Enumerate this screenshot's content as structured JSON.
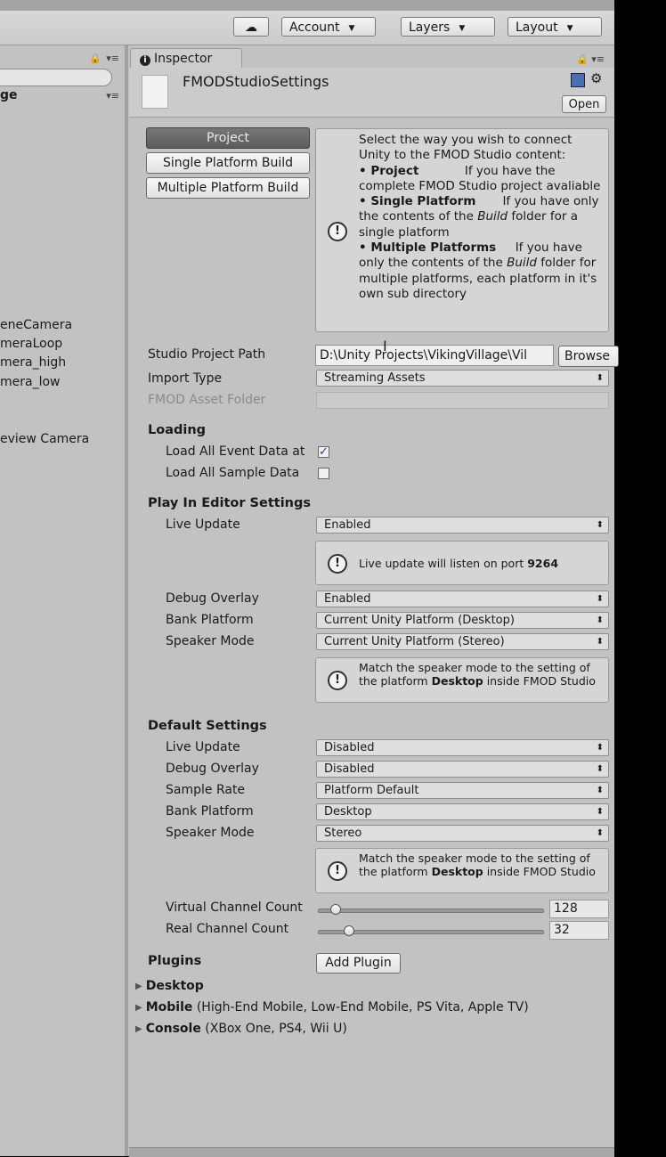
{
  "toolbar": {
    "account_label": "Account",
    "layers_label": "Layers",
    "layout_label": "Layout",
    "cloud_icon": "cloud-icon"
  },
  "hierarchy": {
    "title": "ge",
    "items": [
      "eneCamera",
      "meraLoop",
      "mera_high",
      "mera_low",
      "eview Camera"
    ]
  },
  "inspector": {
    "tab_label": "Inspector",
    "asset_name": "FMODStudioSettings",
    "open_label": "Open",
    "mode_buttons": [
      "Project",
      "Single Platform Build",
      "Multiple Platform Build"
    ],
    "active_mode": "Project",
    "help": {
      "intro": "Select the way you wish to connect Unity to the FMOD Studio content:",
      "project_title": "• Project",
      "project_text": "If you have the complete FMOD Studio project avaliable",
      "single_title": "• Single Platform",
      "single_text_a": "If you have only the contents of the",
      "single_build": "Build",
      "single_text_b": "folder for a single platform",
      "multi_title": "• Multiple Platforms",
      "multi_text_a": "If you have only the contents of the",
      "multi_build": "Build",
      "multi_text_b": "folder for multiple platforms, each platform in it's own sub directory"
    },
    "studio_project_path_label": "Studio Project Path",
    "studio_project_path_value": "D:\\Unity Projects\\VikingVillage\\Vil",
    "browse_label": "Browse",
    "import_type_label": "Import Type",
    "import_type_value": "Streaming Assets",
    "asset_folder_label": "FMOD Asset Folder",
    "loading": {
      "title": "Loading",
      "load_events_label": "Load All Event Data at",
      "load_events_checked": true,
      "load_samples_label": "Load All Sample Data",
      "load_samples_checked": false
    },
    "play_in_editor": {
      "title": "Play In Editor Settings",
      "live_update_label": "Live Update",
      "live_update_value": "Enabled",
      "live_info_text": "Live update will listen on port",
      "live_info_port": "9264",
      "debug_overlay_label": "Debug Overlay",
      "debug_overlay_value": "Enabled",
      "bank_platform_label": "Bank Platform",
      "bank_platform_value": "Current Unity Platform (Desktop)",
      "speaker_mode_label": "Speaker Mode",
      "speaker_mode_value": "Current Unity Platform (Stereo)",
      "speaker_info_a": "Match the speaker mode to the setting of the platform",
      "speaker_info_bold": "Desktop",
      "speaker_info_b": "inside FMOD Studio"
    },
    "defaults": {
      "title": "Default Settings",
      "live_update_label": "Live Update",
      "live_update_value": "Disabled",
      "debug_overlay_label": "Debug Overlay",
      "debug_overlay_value": "Disabled",
      "sample_rate_label": "Sample Rate",
      "sample_rate_value": "Platform Default",
      "bank_platform_label": "Bank Platform",
      "bank_platform_value": "Desktop",
      "speaker_mode_label": "Speaker Mode",
      "speaker_mode_value": "Stereo",
      "speaker_info_a": "Match the speaker mode to the setting of the platform",
      "speaker_info_bold": "Desktop",
      "speaker_info_b": "inside FMOD Studio",
      "virtual_channel_label": "Virtual Channel Count",
      "virtual_channel_value": "128",
      "virtual_channel_fraction": 0.08,
      "real_channel_label": "Real Channel Count",
      "real_channel_value": "32",
      "real_channel_fraction": 0.14
    },
    "plugins": {
      "title": "Plugins",
      "add_label": "Add Plugin"
    },
    "platform_groups": [
      {
        "name": "Desktop",
        "detail": ""
      },
      {
        "name": "Mobile",
        "detail": "(High-End Mobile, Low-End Mobile, PS Vita, Apple TV)"
      },
      {
        "name": "Console",
        "detail": "(XBox One, PS4, Wii U)"
      }
    ]
  }
}
